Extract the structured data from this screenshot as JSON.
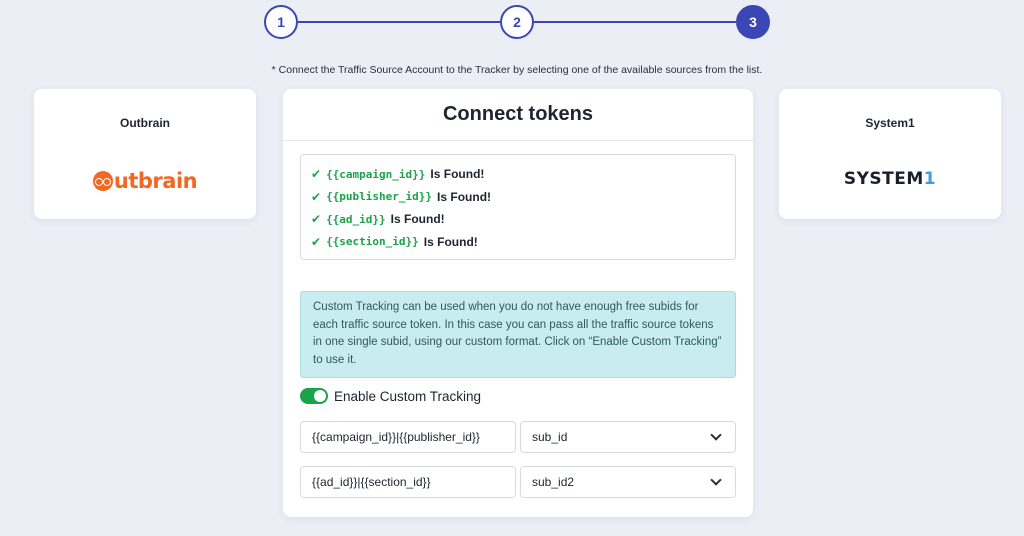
{
  "stepper": {
    "steps": [
      "1",
      "2",
      "3"
    ],
    "active_step": "3"
  },
  "hint": "* Connect the Traffic Source Account to the Tracker by selecting one of the available sources from the list.",
  "sources": {
    "left": {
      "name": "Outbrain",
      "logo_text": "utbrain"
    },
    "right": {
      "name": "System1",
      "logo_text": "SYSTEM",
      "logo_accent": "1"
    }
  },
  "panel": {
    "title": "Connect tokens",
    "tokens": [
      {
        "token": "{{campaign_id}}",
        "status": "Is Found!"
      },
      {
        "token": "{{publisher_id}}",
        "status": "Is Found!"
      },
      {
        "token": "{{ad_id}}",
        "status": "Is Found!"
      },
      {
        "token": "{{section_id}}",
        "status": "Is Found!"
      }
    ],
    "info": "Custom Tracking can be used when you do not have enough free subids for each traffic source token. In this case you can pass all the traffic source tokens in one single subid, using our custom format. Click on “Enable Custom Tracking” to use it.",
    "toggle_label": "Enable Custom Tracking",
    "toggle_on": true,
    "mappings": [
      {
        "value": "{{campaign_id}}|{{publisher_id}}",
        "subid": "sub_id"
      },
      {
        "value": "{{ad_id}}|{{section_id}}",
        "subid": "sub_id2"
      }
    ]
  },
  "colors": {
    "accent": "#3a47b5",
    "success": "#1aa34a",
    "outbrain": "#f26722",
    "info_bg": "#c8ecef"
  }
}
